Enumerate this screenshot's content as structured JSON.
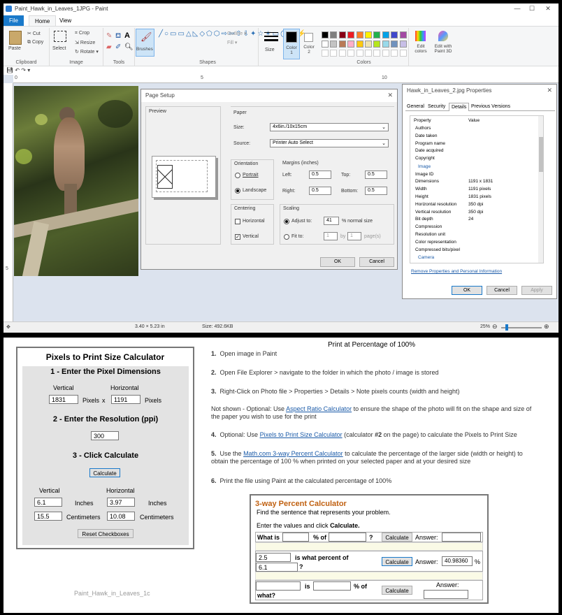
{
  "window": {
    "title": "Paint_Hawk_in_Leaves_1JPG - Paint",
    "min": "—",
    "max": "☐",
    "close": "✕"
  },
  "tabs": {
    "file": "File",
    "home": "Home",
    "view": "View"
  },
  "ribbon": {
    "paste": "Paste",
    "cut": "Cut",
    "copy": "Copy",
    "clipboard": "Clipboard",
    "select": "Select",
    "crop": "Crop",
    "resize": "Resize",
    "rotate": "Rotate ▾",
    "image": "Image",
    "tools": "Tools",
    "brushes": "Brushes",
    "shapes": "Shapes",
    "outline": "Outline ▾",
    "fill": "Fill ▾",
    "size": "Size",
    "color1": "Color 1",
    "color2": "Color 2",
    "colors": "Colors",
    "edit_colors": "Edit colors",
    "edit_3d": "Edit with Paint 3D",
    "palette": [
      "#000000",
      "#7f7f7f",
      "#880015",
      "#ed1c24",
      "#ff7f27",
      "#fff200",
      "#22b14c",
      "#00a2e8",
      "#3f48cc",
      "#a349a4",
      "#ffffff",
      "#c3c3c3",
      "#b97a57",
      "#ffaec9",
      "#ffc90e",
      "#efe4b0",
      "#b5e61d",
      "#99d9ea",
      "#7092be",
      "#c8bfe7"
    ]
  },
  "ruler": {
    "t0": "0",
    "t5": "5",
    "t10": "10",
    "v5": "5"
  },
  "status": {
    "dims": "3.40 × 5.23 in",
    "size": "Size: 492.6KB",
    "zoom": "25%"
  },
  "page_setup": {
    "title": "Page Setup",
    "preview": "Preview",
    "paper": "Paper",
    "size_label": "Size:",
    "size_val": "4x6in./10x15cm",
    "source_label": "Source:",
    "source_val": "Printer Auto Select",
    "orientation": "Orientation",
    "portrait": "Portrait",
    "landscape": "Landscape",
    "margins": "Margins (inches)",
    "left": "Left:",
    "left_v": "0.5",
    "top": "Top:",
    "top_v": "0.5",
    "right": "Right:",
    "right_v": "0.5",
    "bottom": "Bottom:",
    "bottom_v": "0.5",
    "centering": "Centering",
    "horizontal": "Horizontal",
    "vertical": "Vertical",
    "scaling": "Scaling",
    "adjust": "Adjust to:",
    "adjust_v": "41",
    "normal": "% normal size",
    "fit": "Fit to:",
    "fit_a": "1",
    "by": "by",
    "fit_b": "1",
    "pages": "page(s)",
    "ok": "OK",
    "cancel": "Cancel"
  },
  "props": {
    "title": "Hawk_in_Leaves_2.jpg Properties",
    "tabs": [
      "General",
      "Security",
      "Details",
      "Previous Versions"
    ],
    "col_property": "Property",
    "col_value": "Value",
    "rows": [
      [
        "Authors",
        ""
      ],
      [
        "Date taken",
        ""
      ],
      [
        "Program name",
        ""
      ],
      [
        "Date acquired",
        ""
      ],
      [
        "Copyright",
        ""
      ]
    ],
    "image_section": "Image",
    "img_rows": [
      [
        "Image ID",
        ""
      ],
      [
        "Dimensions",
        "1191 x 1831"
      ],
      [
        "Width",
        "1191 pixels"
      ],
      [
        "Height",
        "1831 pixels"
      ],
      [
        "Horizontal resolution",
        "350 dpi"
      ],
      [
        "Vertical resolution",
        "350 dpi"
      ],
      [
        "Bit depth",
        "24"
      ],
      [
        "Compression",
        ""
      ],
      [
        "Resolution unit",
        ""
      ],
      [
        "Color representation",
        ""
      ],
      [
        "Compressed bits/pixel",
        ""
      ]
    ],
    "camera": "Camera",
    "remove": "Remove Properties and Personal Information",
    "ok": "OK",
    "cancel": "Cancel",
    "apply": "Apply"
  },
  "calc": {
    "title": "Pixels to Print Size Calculator",
    "s1": "1 - Enter the Pixel Dimensions",
    "vertical": "Vertical",
    "horizontal": "Horizontal",
    "v_px": "1831",
    "h_px": "1191",
    "pixels": "Pixels",
    "x": "x",
    "s2": "2 - Enter the Resolution (ppi)",
    "ppi": "300",
    "s3": "3 - Click Calculate",
    "calculate": "Calculate",
    "v_in": "6.1",
    "h_in": "3.97",
    "inches": "Inches",
    "v_cm": "15.5",
    "h_cm": "10.08",
    "cm": "Centimeters",
    "reset": "Reset Checkboxes"
  },
  "caption": "Paint_Hawk_in_Leaves_1c",
  "instructions": {
    "header": "Print at Percentage of 100%",
    "s1n": "1.",
    "s1a": "Open image in ",
    "s1b": "Paint",
    "s2n": "2.",
    "s2a": "Open ",
    "s2b": "File Explorer",
    "s2c": " > navigate to the folder in which the photo / image is stored",
    "s3n": "3.",
    "s3a": "Right-Click",
    "s3b": " on Photo file > ",
    "s3c": "Properties",
    "s3d": " > ",
    "s3e": "Details",
    "s3f": " > Note pixels counts (width and height)",
    "note_a": "Not shown - Optional:  Use ",
    "note_link": "Aspect Ratio Calculator",
    "note_b": " to ensure the shape of the photo will fit on the shape and size of the paper you wish to use for the print",
    "s4n": "4.",
    "s4a": "Optional:  Use ",
    "s4link": "Pixels to Print Size Calculator",
    "s4b": " (calculator ",
    "s4c": "#2",
    "s4d": " on the page) to calculate the ",
    "s4e": "Pixels to Print Size",
    "s5n": "5.",
    "s5a": "Use the ",
    "s5link": "Math.com 3-way Percent Calculator",
    "s5b": " to calculate the percentage of the larger side (width or height) to obtain the ",
    "s5c": "percentage of 100 %",
    "s5d": " when printed on your selected paper and at your desired size",
    "s6n": "6.",
    "s6a": "Print the file using Paint at the calculated percentage of 100%"
  },
  "pct": {
    "title": "3-way Percent Calculator",
    "sub": "Find the sentence that represents your problem.",
    "enter": "Enter the values and click ",
    "enter_b": "Calculate.",
    "r1a": "What is",
    "r1b": "% of",
    "r1c": "?",
    "calc": "Calculate",
    "answer": "Answer:",
    "r2v1": "2.5",
    "r2b": "is what percent of",
    "r2v2": "6.1",
    "r2c": "?",
    "r2ans": "40.98360",
    "r2pct": "%",
    "r3b": "is",
    "r3c": "% of",
    "r3d": "what?"
  }
}
